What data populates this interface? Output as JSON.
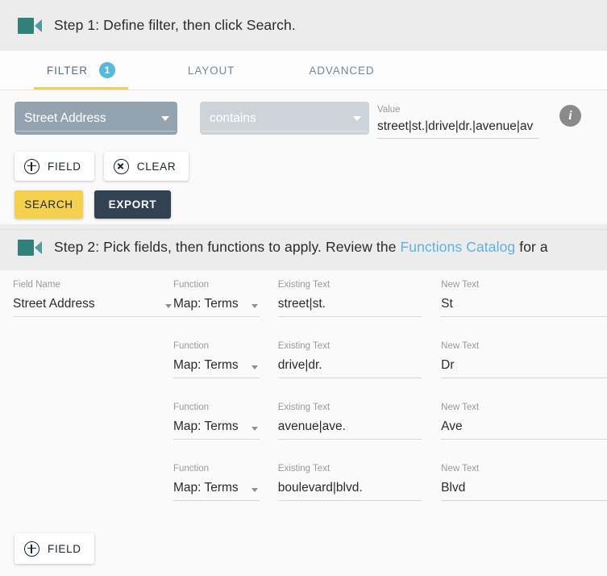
{
  "step1": {
    "icon": "video-camera-icon",
    "text": "Step 1: Define filter, then click Search."
  },
  "tabs": [
    {
      "label": "FILTER",
      "active": true,
      "badge": "1"
    },
    {
      "label": "LAYOUT",
      "active": false,
      "badge": null
    },
    {
      "label": "ADVANCED",
      "active": false,
      "badge": null
    }
  ],
  "filter": {
    "field_value": "Street Address",
    "operator_value": "contains",
    "value_label": "Value",
    "value_text": "street|st.|drive|dr.|avenue|av",
    "info_icon": "info-icon",
    "add_field_label": "FIELD",
    "clear_label": "CLEAR",
    "search_label": "SEARCH",
    "export_label": "EXPORT"
  },
  "step2": {
    "icon": "video-camera-icon",
    "text_before": "Step 2: Pick fields, then functions to apply. Review the ",
    "link_text": "Functions Catalog",
    "text_after": " for a"
  },
  "mapping": {
    "headers": {
      "field_name": "Field Name",
      "function": "Function",
      "existing_text": "Existing Text",
      "new_text": "New Text"
    },
    "rows": [
      {
        "field_name": "Street Address",
        "function": "Map: Terms",
        "existing_text": "street|st.",
        "new_text": "St",
        "show_field": true
      },
      {
        "field_name": "",
        "function": "Map: Terms",
        "existing_text": "drive|dr.",
        "new_text": "Dr",
        "show_field": false
      },
      {
        "field_name": "",
        "function": "Map: Terms",
        "existing_text": "avenue|ave.",
        "new_text": "Ave",
        "show_field": false
      },
      {
        "field_name": "",
        "function": "Map: Terms",
        "existing_text": "boulevard|blvd.",
        "new_text": "Blvd",
        "show_field": false
      }
    ],
    "add_field_label": "FIELD"
  },
  "colors": {
    "accent_yellow": "#f5d04e",
    "accent_navy": "#334155",
    "badge_cyan": "#54bcd8",
    "link_blue": "#5cb3dd",
    "teal_icon": "#31817b",
    "field_select_bg": "#94a3b0",
    "operator_select_bg": "#ccd4da"
  }
}
